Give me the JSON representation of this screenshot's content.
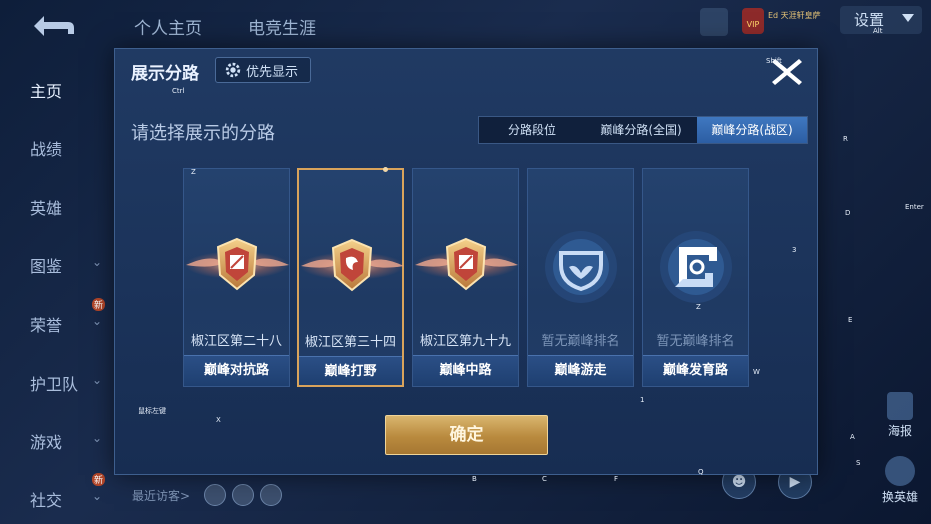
{
  "background": {
    "top_tabs": [
      "个人主页",
      "电竞生涯"
    ],
    "vip_text": "Ed 天涯轩皇萨",
    "settings_label": "设置",
    "side_nav": [
      {
        "label": "主页",
        "has_chevron": false,
        "badge": ""
      },
      {
        "label": "战绩",
        "has_chevron": false,
        "badge": ""
      },
      {
        "label": "英雄",
        "has_chevron": false,
        "badge": ""
      },
      {
        "label": "图鉴",
        "has_chevron": true,
        "badge": ""
      },
      {
        "label": "荣誉",
        "has_chevron": true,
        "badge": "新"
      },
      {
        "label": "护卫队",
        "has_chevron": true,
        "badge": ""
      },
      {
        "label": "游戏",
        "has_chevron": true,
        "badge": ""
      },
      {
        "label": "社交",
        "has_chevron": true,
        "badge": "新"
      }
    ],
    "recent_visitors_label": "最近访客>",
    "poster_label": "海报",
    "hero_label": "换英雄"
  },
  "modal": {
    "title": "展示分路",
    "priority_button": "优先显示",
    "subtitle": "请选择展示的分路",
    "tabs": [
      {
        "label": "分路段位",
        "active": false
      },
      {
        "label": "巅峰分路(全国)",
        "active": false
      },
      {
        "label": "巅峰分路(战区)",
        "active": true
      }
    ],
    "cards": [
      {
        "rank": "椒江区第二十八",
        "role": "巅峰对抗路",
        "has_rank": true,
        "selected": false,
        "emblem_icon": "peak-rank-shield-icon"
      },
      {
        "rank": "椒江区第三十四",
        "role": "巅峰打野",
        "has_rank": true,
        "selected": true,
        "emblem_icon": "peak-rank-shield-icon"
      },
      {
        "rank": "椒江区第九十九",
        "role": "巅峰中路",
        "has_rank": true,
        "selected": false,
        "emblem_icon": "peak-rank-shield-icon"
      },
      {
        "rank": "暂无巅峰排名",
        "role": "巅峰游走",
        "has_rank": false,
        "selected": false,
        "emblem_icon": "support-role-icon"
      },
      {
        "rank": "暂无巅峰排名",
        "role": "巅峰发育路",
        "has_rank": false,
        "selected": false,
        "emblem_icon": "marksman-role-icon"
      }
    ],
    "confirm_button": "确定"
  },
  "colors": {
    "selected_border": "#d9a35b",
    "active_tab": "#3f78c0",
    "confirm_gold": "#c8984a"
  },
  "key_hints": {
    "z_top": "Z",
    "z_icon": "Z",
    "r": "R",
    "d": "D",
    "enter": "Enter",
    "three": "3",
    "e": "E",
    "w": "W",
    "one": "1",
    "x": "X",
    "a": "A",
    "s": "S",
    "q": "Q",
    "b": "B",
    "c": "C",
    "f": "F",
    "ctrl": "Ctrl",
    "shift": "Shift",
    "alt": "Alt",
    "lclick": "鼠标左键"
  }
}
